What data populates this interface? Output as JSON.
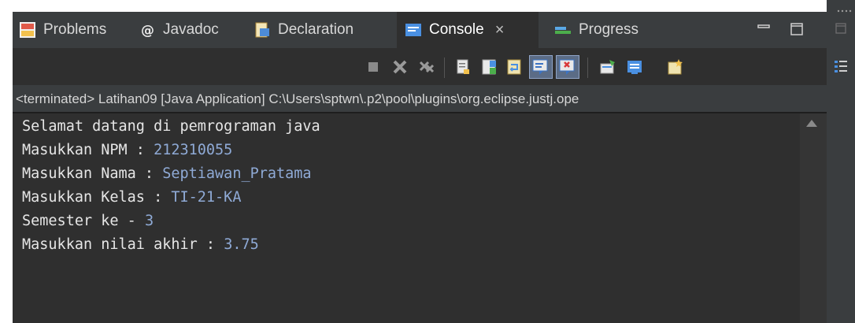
{
  "tabs": [
    {
      "label": "Problems",
      "icon": "problems-icon",
      "active": false
    },
    {
      "label": "Javadoc",
      "icon": "javadoc-icon",
      "active": false
    },
    {
      "label": "Declaration",
      "icon": "declaration-icon",
      "active": false
    },
    {
      "label": "Console",
      "icon": "console-icon",
      "active": true,
      "close": "×"
    },
    {
      "label": "Progress",
      "icon": "progress-icon",
      "active": false
    }
  ],
  "path_text": "<terminated> Latihan09 [Java Application] C:\\Users\\sptwn\\.p2\\pool\\plugins\\org.eclipse.justj.ope",
  "console_lines": [
    {
      "prompt": "Selamat datang di pemrograman java",
      "input": ""
    },
    {
      "prompt": "Masukkan NPM : ",
      "input": "212310055"
    },
    {
      "prompt": "Masukkan Nama : ",
      "input": "Septiawan_Pratama"
    },
    {
      "prompt": "Masukkan Kelas : ",
      "input": "TI-21-KA"
    },
    {
      "prompt": "Semester ke - ",
      "input": "3"
    },
    {
      "prompt": "Masukkan nilai akhir : ",
      "input": "3.75"
    }
  ],
  "colors": {
    "background": "#2f2f2f",
    "input_text": "#8faad6",
    "output_text": "#e6e6e6"
  }
}
